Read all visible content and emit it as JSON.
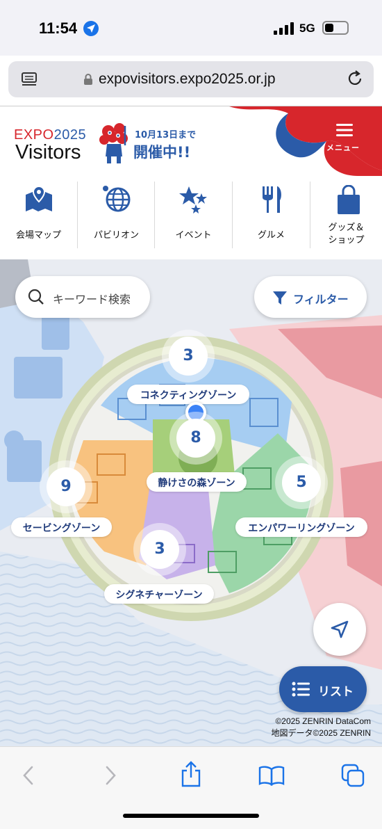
{
  "status_bar": {
    "time": "11:54",
    "network": "5G"
  },
  "browser": {
    "url": "expovisitors.expo2025.or.jp"
  },
  "header": {
    "logo_expo": "EXPO",
    "logo_year": "2025",
    "logo_visitors": "Visitors",
    "date_text": "10月13日まで",
    "status_text": "開催中!!",
    "menu_label": "メニュー",
    "brand_red": "#d7262c",
    "brand_blue": "#2b5ba8"
  },
  "nav": {
    "items": [
      {
        "label": "会場マップ",
        "icon": "map-pin-icon"
      },
      {
        "label": "パビリオン",
        "icon": "globe-icon"
      },
      {
        "label": "イベント",
        "icon": "stars-icon"
      },
      {
        "label": "グルメ",
        "icon": "fork-knife-icon"
      },
      {
        "label_line1": "グッズ＆",
        "label_line2": "ショップ",
        "icon": "shopping-bag-icon"
      }
    ]
  },
  "map": {
    "search_placeholder": "キーワード検索",
    "filter_label": "フィルター",
    "list_label": "リスト",
    "zones": [
      {
        "name": "コネクティングゾーン",
        "count": "3"
      },
      {
        "name": "静けさの森ゾーン",
        "count": "8"
      },
      {
        "name": "セービングゾーン",
        "count": "9"
      },
      {
        "name": "エンパワーリングゾーン",
        "count": "5"
      },
      {
        "name": "シグネチャーゾーン",
        "count": "3"
      }
    ],
    "copyright_line1": "©2025 ZENRIN DataCom",
    "copyright_line2": "地図データ©2025 ZENRIN"
  }
}
